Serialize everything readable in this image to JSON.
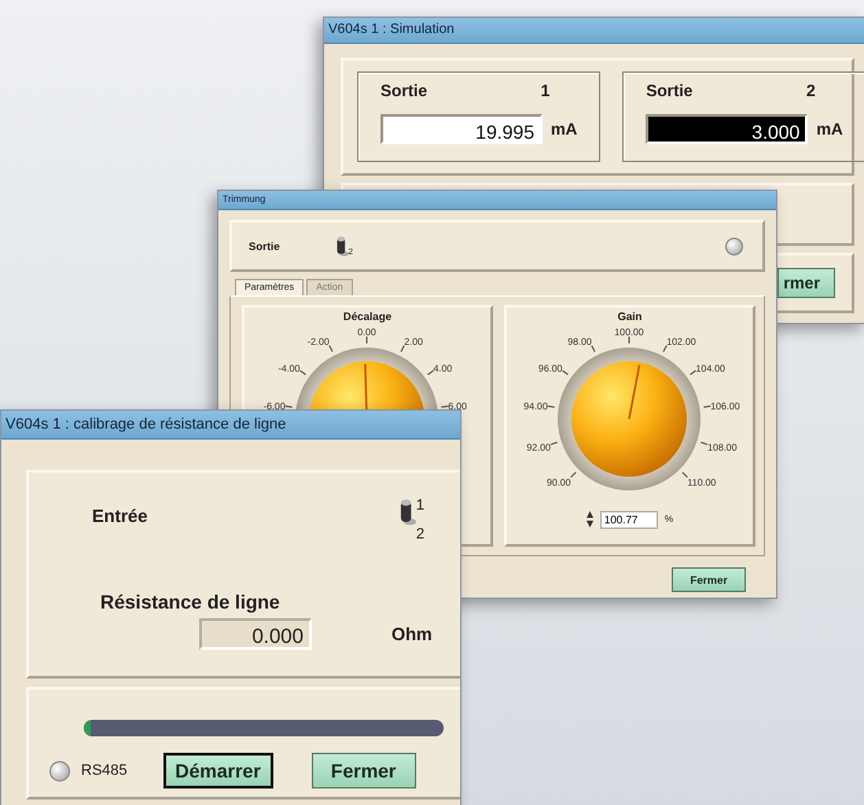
{
  "simulation_window": {
    "title": "V604s 1  : Simulation",
    "outputs": [
      {
        "label": "Sortie",
        "number": "1",
        "value": "19.995",
        "unit": "mA",
        "selected": false
      },
      {
        "label": "Sortie",
        "number": "2",
        "value": "3.000",
        "unit": "mA",
        "selected": true
      }
    ],
    "button": "rmer"
  },
  "trimming_window": {
    "title": "Trimmung",
    "output_label": "Sortie",
    "switch_label": "2",
    "lit": false,
    "tabs": [
      {
        "label": "Paramètres",
        "selected": true
      },
      {
        "label": "Action",
        "selected": false
      }
    ],
    "dials": [
      {
        "title": "Décalage",
        "level": 0.49,
        "ticks": [
          "-6.00",
          "-4.00",
          "-2.00",
          "0.00",
          "2.00",
          "4.00",
          "6.00"
        ]
      },
      {
        "title": "Gain",
        "level": 0.54,
        "ticks": [
          "90.00",
          "92.00",
          "94.00",
          "96.00",
          "98.00",
          "100.00",
          "102.00",
          "104.00",
          "106.00",
          "108.00",
          "110.00"
        ],
        "value": "100.77",
        "unit": "%"
      }
    ],
    "button": "Fermer"
  },
  "calibration_window": {
    "title": "V604s 1  : calibrage de résistance de ligne",
    "input_label": "Entrée",
    "switch_labels": [
      "1",
      "2"
    ],
    "resistance_label": "Résistance de ligne",
    "resistance_value": "0.000",
    "resistance_unit": "Ohm",
    "progress": {
      "level": 0.02
    },
    "indicator": {
      "label": "RS485",
      "lit": false
    },
    "buttons": [
      {
        "label": "Démarrer",
        "focused": true
      },
      {
        "label": "Fermer",
        "focused": false
      }
    ]
  }
}
